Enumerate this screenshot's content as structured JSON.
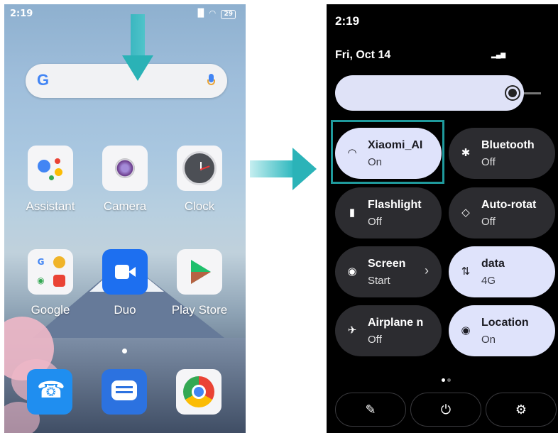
{
  "left_phone": {
    "status": {
      "time": "2:19",
      "signal": "▂▄▆",
      "wifi": "wifi",
      "battery": "29"
    },
    "search": {
      "logo": "G"
    },
    "apps": [
      {
        "label": "Assistant"
      },
      {
        "label": "Camera"
      },
      {
        "label": "Clock"
      },
      {
        "label": "Google"
      },
      {
        "label": "Duo"
      },
      {
        "label": "Play Store"
      }
    ],
    "dock": [
      "Phone",
      "Messages",
      "Chrome"
    ]
  },
  "quick_settings": {
    "time": "2:19",
    "date": "Fri, Oct 14",
    "tiles": [
      {
        "title": "Xiaomi_AI",
        "state": "On",
        "icon": "wifi-icon",
        "active": true
      },
      {
        "title": "Bluetooth",
        "state": "Off",
        "icon": "bluetooth-icon",
        "active": false
      },
      {
        "title": "Flashlight",
        "state": "Off",
        "icon": "flashlight-icon",
        "active": false
      },
      {
        "title": "Auto-rotat",
        "state": "Off",
        "icon": "rotate-icon",
        "active": false
      },
      {
        "title": "Screen",
        "state": "Start",
        "icon": "screen-record-icon",
        "active": false
      },
      {
        "title": "data",
        "state": "4G",
        "icon": "mobile-data-icon",
        "active": true
      },
      {
        "title": "Airplane n",
        "state": "Off",
        "icon": "airplane-icon",
        "active": false
      },
      {
        "title": "Location",
        "state": "On",
        "icon": "location-icon",
        "active": true
      }
    ],
    "bottom_buttons": [
      "edit-icon",
      "power-icon",
      "settings-icon"
    ]
  },
  "colors": {
    "accent_teal": "#2bb3b8",
    "tile_on": "#dfe3fb",
    "tile_off": "#2c2c30",
    "highlight": "#1f9a9c"
  }
}
